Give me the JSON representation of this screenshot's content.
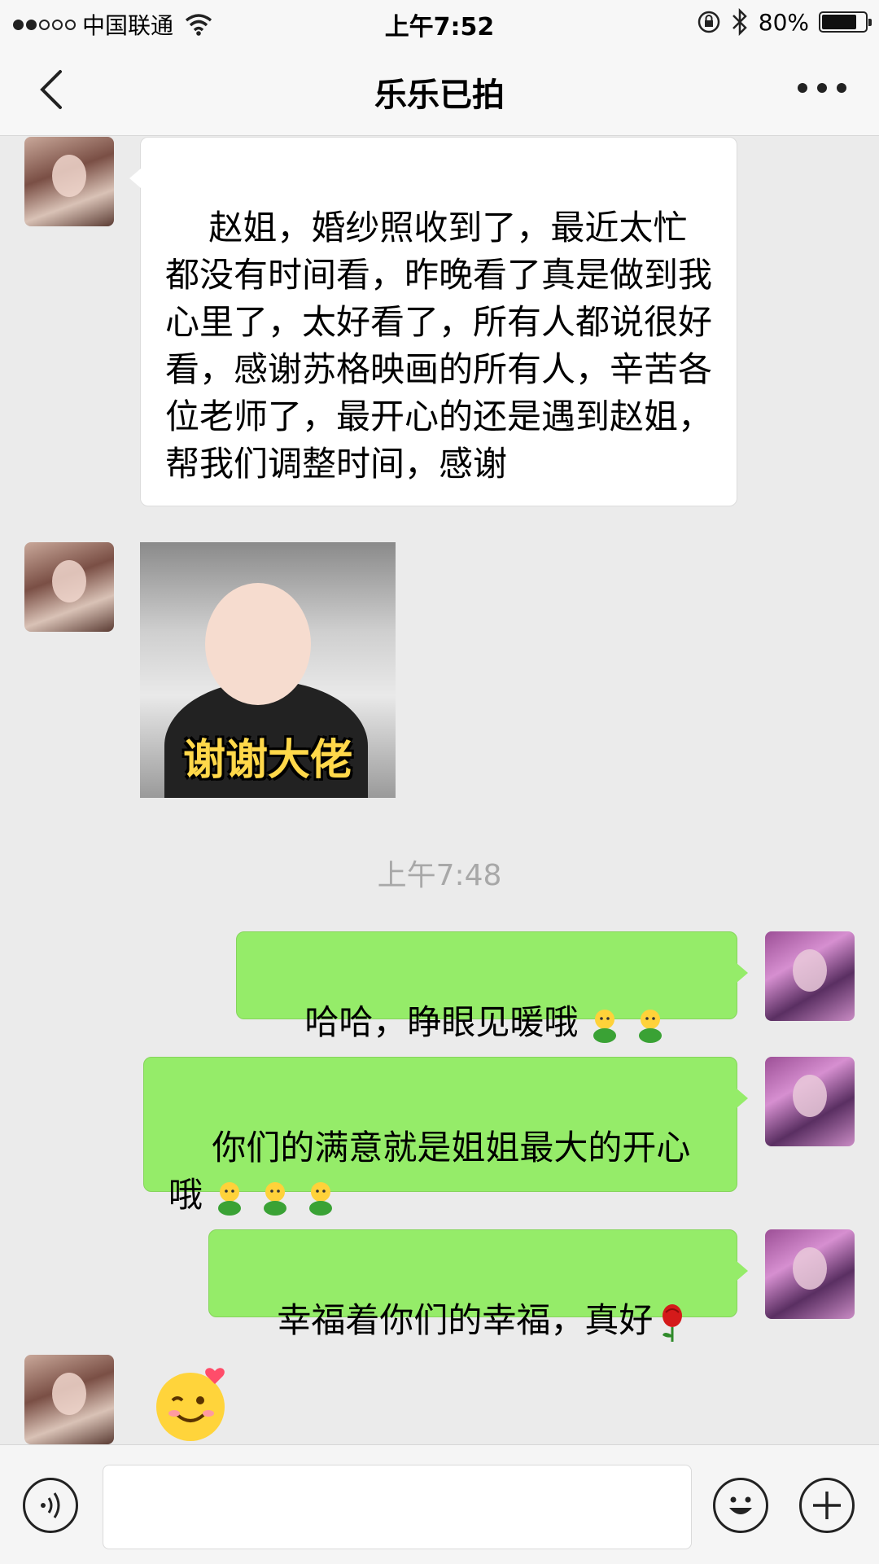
{
  "status_bar": {
    "carrier": "中国联通",
    "time": "上午7:52",
    "battery": "80%",
    "battery_level": 0.8
  },
  "nav": {
    "title": "乐乐已拍"
  },
  "messages": {
    "m1": "赵姐，婚纱照收到了，最近太忙都没有时间看，昨晚看了真是做到我心里了，太好看了，所有人都说很好看，感谢苏格映画的所有人，辛苦各位老师了，最开心的还是遇到赵姐，帮我们调整时间，感谢",
    "sticker_caption": "谢谢大佬",
    "timestamp": "上午7:48",
    "m2": "哈哈，睁眼见暖哦",
    "m3": "你们的满意就是姐姐最大的开心哦",
    "m4": "幸福着你们的幸福，真好"
  },
  "colors": {
    "chat_bg": "#ebebeb",
    "green_bubble": "#95ec69",
    "white_bubble": "#ffffff"
  },
  "icons": {
    "back": "chevron-left-icon",
    "more": "more-dots-icon",
    "voice": "voice-icon",
    "emoji": "smiley-icon",
    "plus": "plus-icon"
  }
}
